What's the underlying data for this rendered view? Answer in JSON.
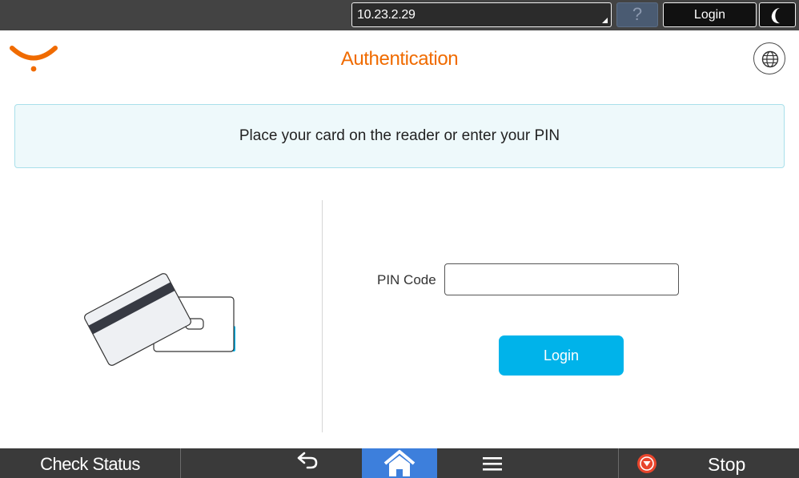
{
  "topbar": {
    "address": "10.23.2.29",
    "help_label": "?",
    "login_label": "Login"
  },
  "header": {
    "title": "Authentication"
  },
  "message": {
    "text": "Place your card on the reader or enter your PIN"
  },
  "pin": {
    "label": "PIN Code",
    "value": "",
    "placeholder": ""
  },
  "login_button": {
    "label": "Login"
  },
  "bottombar": {
    "check_status_label": "Check Status",
    "stop_label": "Stop"
  },
  "icons": {
    "logo": "logo-icon",
    "globe": "globe-icon",
    "sleep": "moon-icon",
    "back": "back-arrow-icon",
    "home": "home-icon",
    "menu": "hamburger-menu-icon",
    "stop": "stop-icon",
    "card": "card-reader-icon"
  },
  "colors": {
    "title_orange": "#f06b00",
    "accent_blue": "#00b3ea",
    "home_blue": "#3d7fdc",
    "bar_dark": "#3a3a3a",
    "message_bg": "#eef9fb",
    "stop_red": "#e8452c"
  }
}
